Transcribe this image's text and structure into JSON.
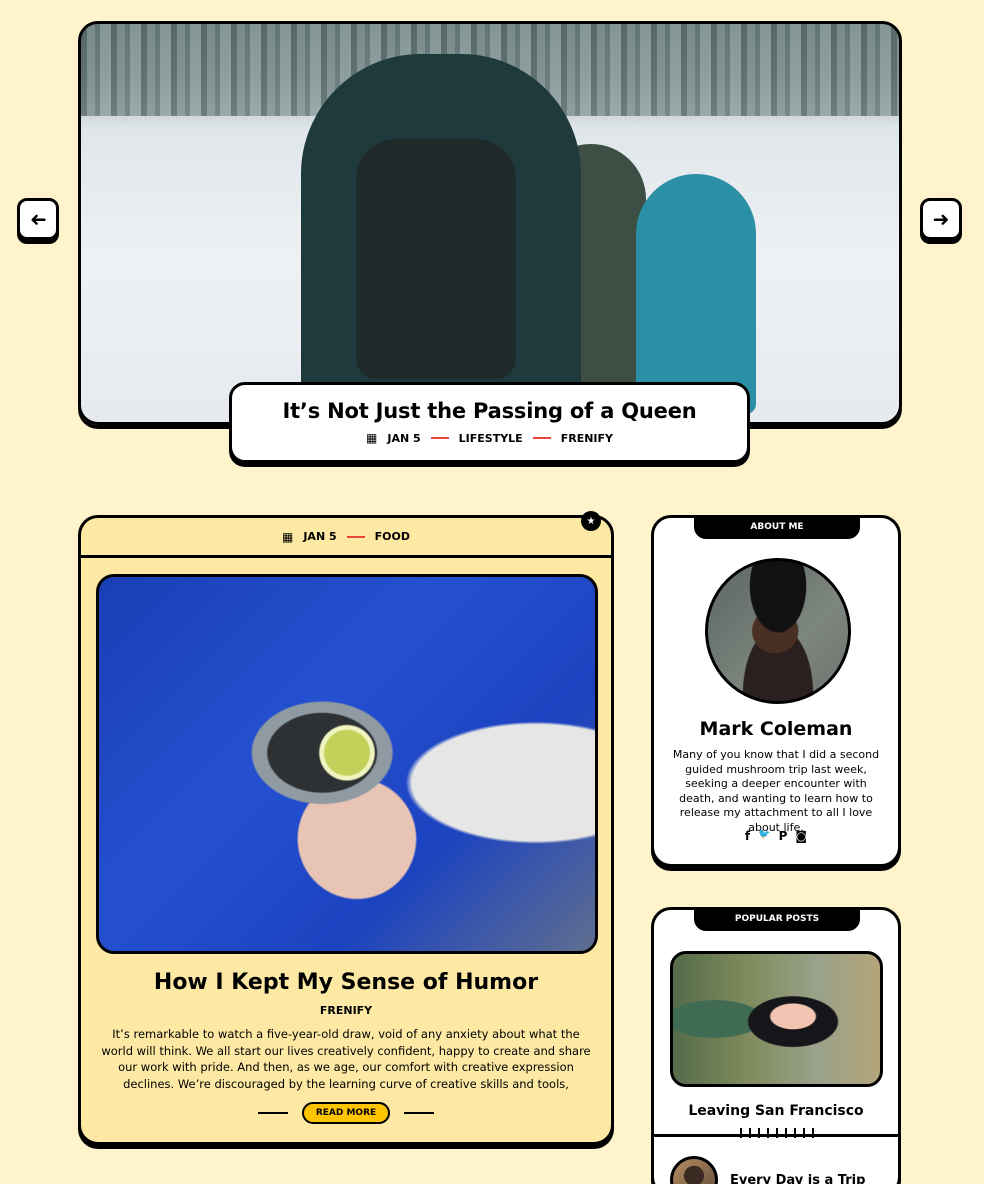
{
  "slider": {
    "prev_icon": "arrow-left-icon",
    "next_icon": "arrow-right-icon",
    "prev_glyph": "➜",
    "next_glyph": "➜",
    "title": "It’s Not Just the Passing of a Queen",
    "date": "JAN 5",
    "category": "LIFESTYLE",
    "author": "FRENIFY"
  },
  "post": {
    "date": "JAN 5",
    "category": "FOOD",
    "sticky_glyph": "★",
    "title": "How I Kept My Sense of Humor",
    "author": "FRENIFY",
    "excerpt": "It’s remarkable to watch a five-year-old draw, void of any anxiety about what the world will think. We all start our lives creatively confident, happy to create and share our work with pride. And then, as we age, our comfort with creative expression declines. We’re discouraged by the learning curve of creative skills and tools,",
    "read_more": "READ MORE"
  },
  "about": {
    "tab": "ABOUT ME",
    "name": "Mark Coleman",
    "bio": "Many of you know that I did a second guided mushroom trip last week, seeking a deeper encounter with death, and wanting to learn how to release my attachment to all I love about life.",
    "socials": [
      {
        "icon": "facebook-icon",
        "glyph": "f"
      },
      {
        "icon": "twitter-icon",
        "glyph": "🐦"
      },
      {
        "icon": "pinterest-icon",
        "glyph": "P"
      },
      {
        "icon": "instagram-icon",
        "glyph": "◙"
      }
    ]
  },
  "popular": {
    "tab": "POPULAR POSTS",
    "items": [
      {
        "title": "Leaving San Francisco"
      },
      {
        "title": "Every Day is a Trip"
      }
    ]
  },
  "colors": {
    "background": "#fff3cc",
    "card": "#fde9a3",
    "accent_dash": "#e8453c",
    "button": "#ffc400"
  }
}
